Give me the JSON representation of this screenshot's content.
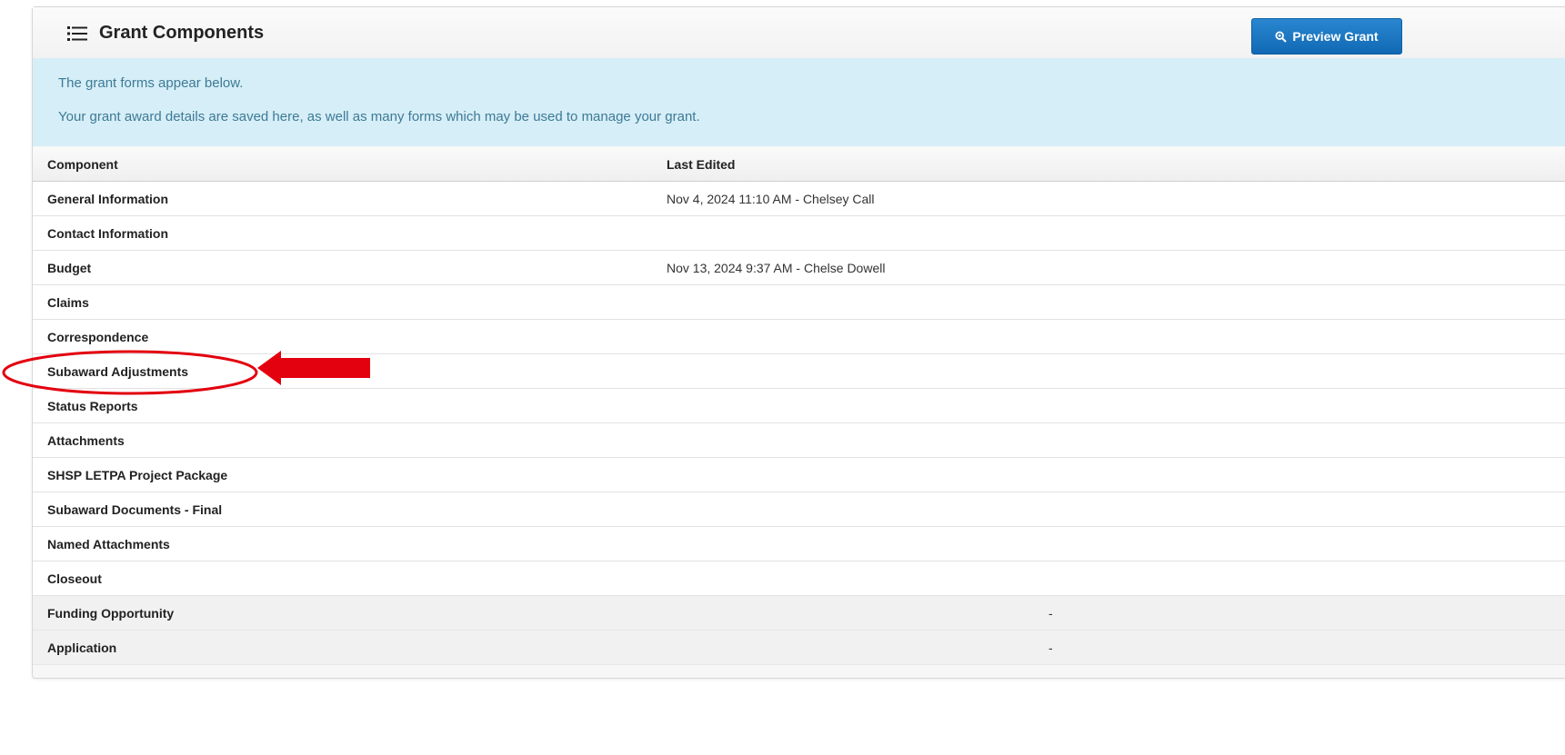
{
  "panel": {
    "title": "Grant Components",
    "title_icon": "list-icon",
    "preview_button": {
      "label": "Preview Grant",
      "icon": "magnifier-icon"
    }
  },
  "info": {
    "line1": "The grant forms appear below.",
    "line2": "Your grant award details are saved here, as well as many forms which may be used to manage your grant."
  },
  "table": {
    "headers": {
      "component": "Component",
      "last_edited": "Last Edited"
    },
    "rows": [
      {
        "component": "General Information",
        "last_edited": "Nov 4, 2024 11:10 AM - Chelsey Call",
        "extra": ""
      },
      {
        "component": "Contact Information",
        "last_edited": "",
        "extra": ""
      },
      {
        "component": "Budget",
        "last_edited": "Nov 13, 2024 9:37 AM - Chelse Dowell",
        "extra": ""
      },
      {
        "component": "Claims",
        "last_edited": "",
        "extra": ""
      },
      {
        "component": "Correspondence",
        "last_edited": "",
        "extra": ""
      },
      {
        "component": "Subaward Adjustments",
        "last_edited": "",
        "extra": ""
      },
      {
        "component": "Status Reports",
        "last_edited": "",
        "extra": ""
      },
      {
        "component": "Attachments",
        "last_edited": "",
        "extra": ""
      },
      {
        "component": "SHSP LETPA Project Package",
        "last_edited": "",
        "extra": ""
      },
      {
        "component": "Subaward Documents - Final",
        "last_edited": "",
        "extra": ""
      },
      {
        "component": "Named Attachments",
        "last_edited": "",
        "extra": ""
      },
      {
        "component": "Closeout",
        "last_edited": "",
        "extra": ""
      },
      {
        "component": "Funding Opportunity",
        "last_edited": "",
        "extra": "-"
      },
      {
        "component": "Application",
        "last_edited": "",
        "extra": "-"
      }
    ]
  },
  "annotation": {
    "highlight_color": "#e3000f",
    "target": "Subaward Adjustments"
  },
  "colors": {
    "button": "#1a73bf",
    "info_bg": "#d6eef7",
    "info_text": "#3d7a96"
  }
}
